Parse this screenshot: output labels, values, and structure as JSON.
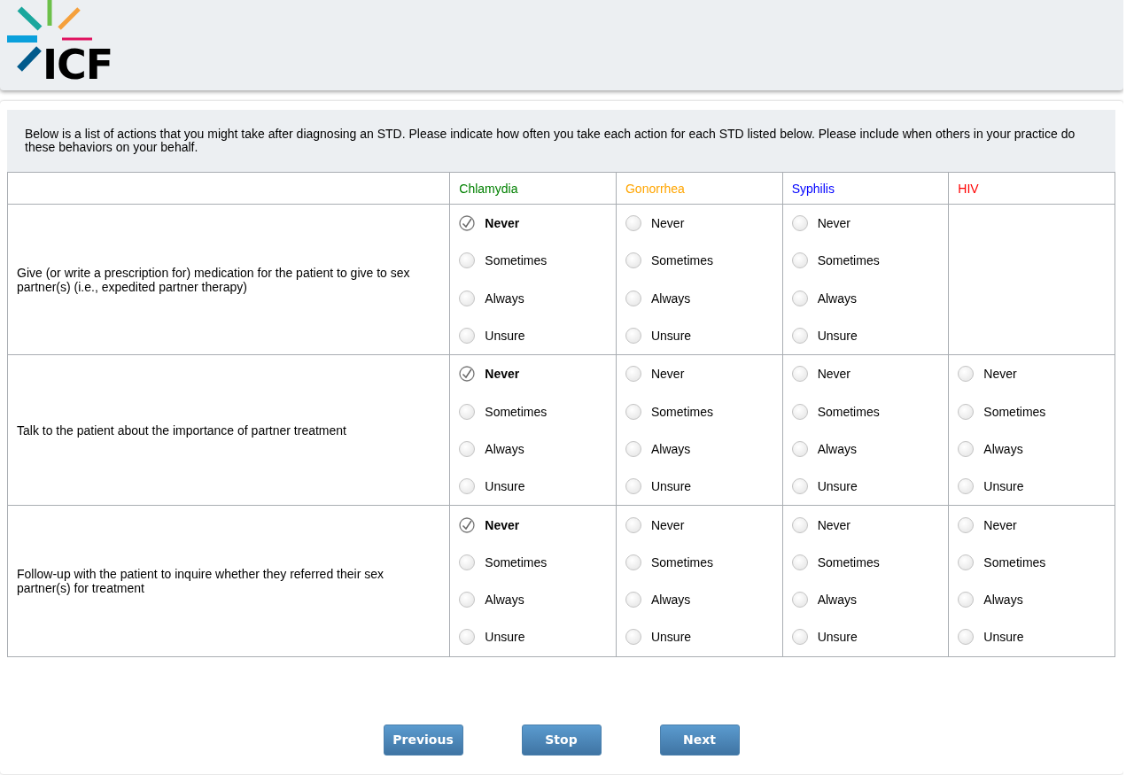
{
  "logo": {
    "text": "ICF"
  },
  "instructions": "Below is a list of actions that you might take after diagnosing an STD. Please indicate how often you take each action for each STD listed below. Please include when others in your practice do these behaviors on your behalf.",
  "columns": [
    {
      "label": "Chlamydia",
      "color": "#008000"
    },
    {
      "label": "Gonorrhea",
      "color": "#ffa500"
    },
    {
      "label": "Syphilis",
      "color": "#0000ff"
    },
    {
      "label": "HIV",
      "color": "#ff0000"
    }
  ],
  "rows": [
    {
      "label": "Give (or write a prescription for) medication for the patient to give to sex partner(s) (i.e., expedited partner therapy)",
      "cells": [
        {
          "kind": "radio",
          "options": [
            {
              "label": "Never",
              "selected": true
            },
            {
              "label": "Sometimes",
              "selected": false
            },
            {
              "label": "Always",
              "selected": false
            },
            {
              "label": "Unsure",
              "selected": false
            }
          ]
        },
        {
          "kind": "radio",
          "options": [
            {
              "label": "Never",
              "selected": false
            },
            {
              "label": "Sometimes",
              "selected": false
            },
            {
              "label": "Always",
              "selected": false
            },
            {
              "label": "Unsure",
              "selected": false
            }
          ]
        },
        {
          "kind": "radio",
          "options": [
            {
              "label": "Never",
              "selected": false
            },
            {
              "label": "Sometimes",
              "selected": false
            },
            {
              "label": "Always",
              "selected": false
            },
            {
              "label": "Unsure",
              "selected": false
            }
          ]
        },
        {
          "kind": "empty"
        }
      ]
    },
    {
      "label": "Talk to the patient about the importance of partner treatment",
      "cells": [
        {
          "kind": "radio",
          "options": [
            {
              "label": "Never",
              "selected": true
            },
            {
              "label": "Sometimes",
              "selected": false
            },
            {
              "label": "Always",
              "selected": false
            },
            {
              "label": "Unsure",
              "selected": false
            }
          ]
        },
        {
          "kind": "radio",
          "options": [
            {
              "label": "Never",
              "selected": false
            },
            {
              "label": "Sometimes",
              "selected": false
            },
            {
              "label": "Always",
              "selected": false
            },
            {
              "label": "Unsure",
              "selected": false
            }
          ]
        },
        {
          "kind": "radio",
          "options": [
            {
              "label": "Never",
              "selected": false
            },
            {
              "label": "Sometimes",
              "selected": false
            },
            {
              "label": "Always",
              "selected": false
            },
            {
              "label": "Unsure",
              "selected": false
            }
          ]
        },
        {
          "kind": "radio",
          "options": [
            {
              "label": "Never",
              "selected": false
            },
            {
              "label": "Sometimes",
              "selected": false
            },
            {
              "label": "Always",
              "selected": false
            },
            {
              "label": "Unsure",
              "selected": false
            }
          ]
        }
      ]
    },
    {
      "label": "Follow-up with the patient to inquire whether they referred their sex partner(s) for treatment",
      "cells": [
        {
          "kind": "radio",
          "options": [
            {
              "label": "Never",
              "selected": true
            },
            {
              "label": "Sometimes",
              "selected": false
            },
            {
              "label": "Always",
              "selected": false
            },
            {
              "label": "Unsure",
              "selected": false
            }
          ]
        },
        {
          "kind": "radio",
          "options": [
            {
              "label": "Never",
              "selected": false
            },
            {
              "label": "Sometimes",
              "selected": false
            },
            {
              "label": "Always",
              "selected": false
            },
            {
              "label": "Unsure",
              "selected": false
            }
          ]
        },
        {
          "kind": "radio",
          "options": [
            {
              "label": "Never",
              "selected": false
            },
            {
              "label": "Sometimes",
              "selected": false
            },
            {
              "label": "Always",
              "selected": false
            },
            {
              "label": "Unsure",
              "selected": false
            }
          ]
        },
        {
          "kind": "radio",
          "options": [
            {
              "label": "Never",
              "selected": false
            },
            {
              "label": "Sometimes",
              "selected": false
            },
            {
              "label": "Always",
              "selected": false
            },
            {
              "label": "Unsure",
              "selected": false
            }
          ]
        }
      ]
    }
  ],
  "buttons": [
    "Previous",
    "Stop",
    "Next"
  ]
}
